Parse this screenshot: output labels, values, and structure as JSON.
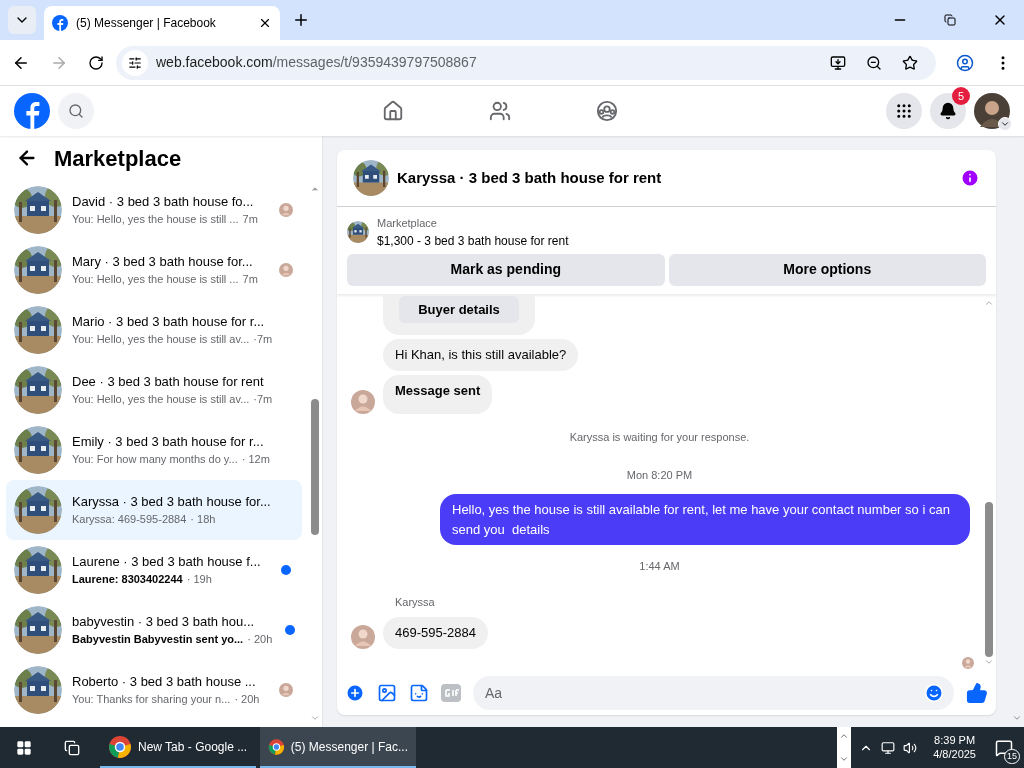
{
  "browser": {
    "tabs": [
      {
        "title": "(5) Messenger | Facebook",
        "selected": true
      }
    ],
    "url_host": "web.facebook.com",
    "url_path": "/messages/t/9359439797508867"
  },
  "header": {
    "notification_count": "5"
  },
  "sidebar": {
    "title": "Marketplace",
    "conversations": [
      {
        "title": "David · 3 bed 3 bath house fo...",
        "preview": "You: Hello, yes the house is still ...",
        "time": "7m",
        "selected": false,
        "unread": false,
        "seen": true
      },
      {
        "title": "Mary · 3 bed 3 bath house for...",
        "preview": "You: Hello, yes the house is still ...",
        "time": "7m",
        "selected": false,
        "unread": false,
        "seen": true
      },
      {
        "title": "Mario · 3 bed 3 bath house for r...",
        "preview": "You: Hello, yes the house is still av...",
        "time": "·7m",
        "selected": false,
        "unread": false,
        "seen": false
      },
      {
        "title": "Dee · 3 bed 3 bath house for rent",
        "preview": "You: Hello, yes the house is still av...",
        "time": "·7m",
        "selected": false,
        "unread": false,
        "seen": false
      },
      {
        "title": "Emily · 3 bed 3 bath house for r...",
        "preview": "You: For how many months do y...",
        "time": "· 12m",
        "selected": false,
        "unread": false,
        "seen": false
      },
      {
        "title": "Karyssa · 3 bed 3 bath house for...",
        "preview": "Karyssa: 469-595-2884",
        "time": "· 18h",
        "selected": true,
        "unread": false,
        "seen": false
      },
      {
        "title": "Laurene · 3 bed 3 bath house f...",
        "preview": "Laurene: 8303402244",
        "time": "· 19h",
        "selected": false,
        "unread": true,
        "seen": false
      },
      {
        "title": "babyvestin · 3 bed 3 bath hou...",
        "preview": "Babyvestin Babyvestin sent yo...",
        "time": "· 20h",
        "selected": false,
        "unread": true,
        "seen": false
      },
      {
        "title": "Roberto · 3 bed 3 bath house ...",
        "preview": "You: Thanks for sharing your n...",
        "time": "· 20h",
        "selected": false,
        "unread": false,
        "seen": true
      }
    ]
  },
  "chat": {
    "title": "Karyssa · 3 bed 3 bath house for rent",
    "listing_label": "Marketplace",
    "listing_title": "$1,300 - 3 bed 3 bath house for rent",
    "buttons": [
      "Mark as pending",
      "More options"
    ],
    "messages": [
      {
        "kind": "card-button",
        "text": "Buyer details"
      },
      {
        "kind": "incoming",
        "text": "Hi Khan, is this still available?",
        "avatar": false,
        "bold": false
      },
      {
        "kind": "incoming",
        "text": "Message sent",
        "avatar": true,
        "bold": true
      },
      {
        "kind": "system",
        "text": "Karyssa is waiting for your response."
      },
      {
        "kind": "timestamp",
        "text": "Mon 8:20 PM"
      },
      {
        "kind": "outgoing",
        "text": "Hello, yes the house is still available for rent, let me have your contact number so i can send you  details"
      },
      {
        "kind": "timestamp",
        "text": "1:44 AM"
      },
      {
        "kind": "sender",
        "text": "Karyssa"
      },
      {
        "kind": "incoming",
        "text": "469-595-2884",
        "avatar": true,
        "bold": false
      }
    ],
    "composer_placeholder": "Aa"
  },
  "taskbar": {
    "apps": [
      {
        "label": "New Tab - Google ...",
        "selected": false
      },
      {
        "label": "(5) Messenger | Fac...",
        "selected": true
      }
    ],
    "time": "8:39 PM",
    "date": "4/8/2025",
    "notification_count": "15"
  }
}
